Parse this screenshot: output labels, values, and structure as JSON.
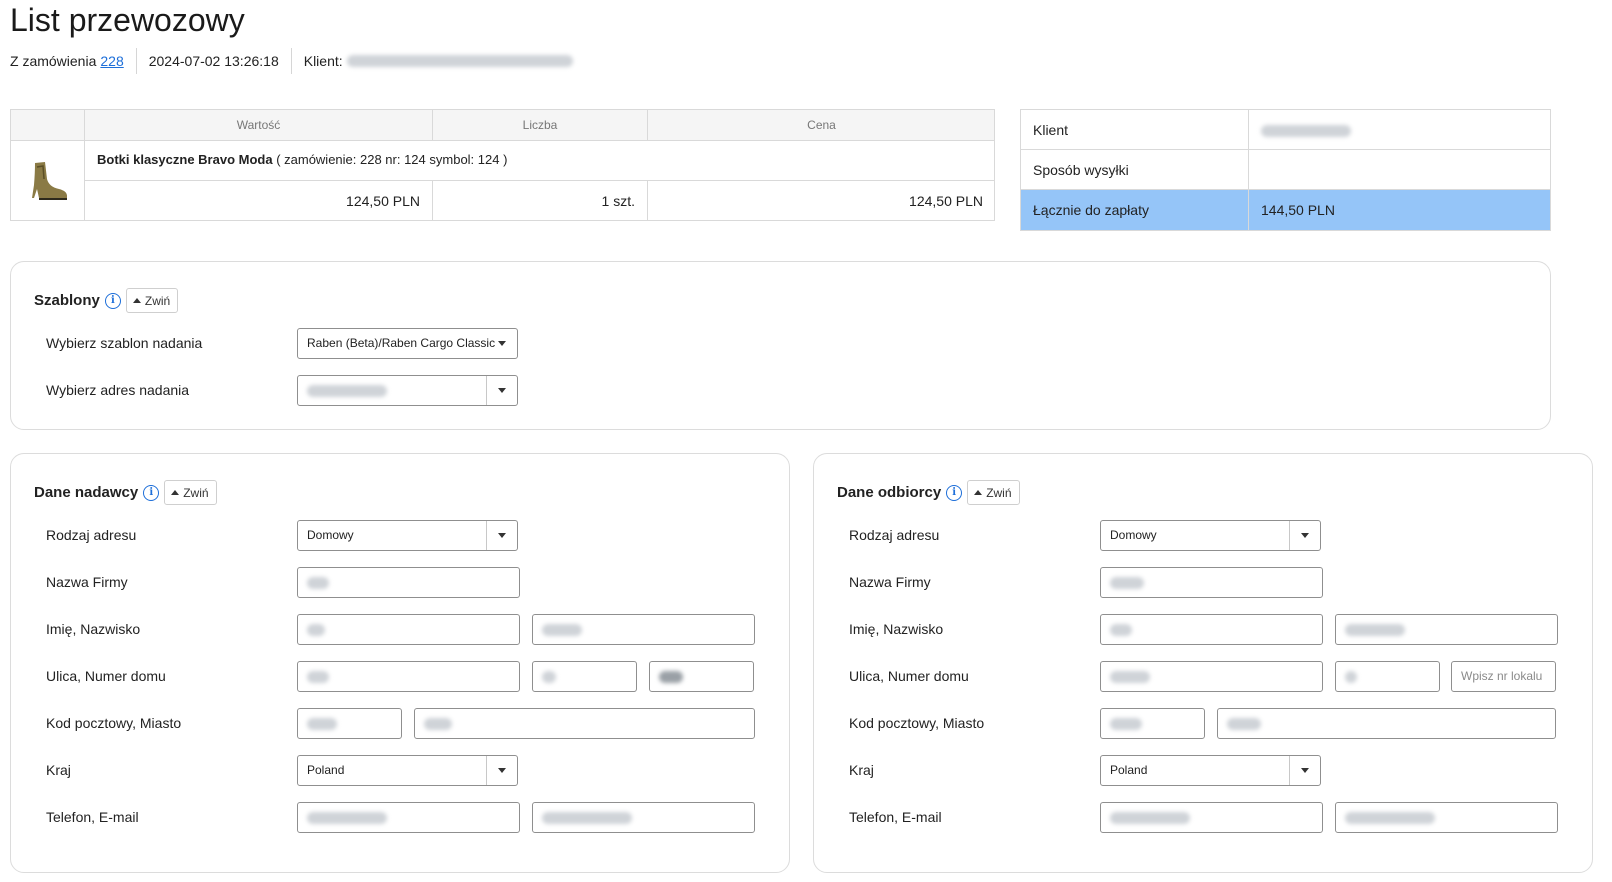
{
  "page": {
    "title": "List przewozowy"
  },
  "meta": {
    "from_order_label": "Z zamówienia",
    "order_number": "228",
    "datetime": "2024-07-02 13:26:18",
    "client_label": "Klient:"
  },
  "order_table": {
    "headers": [
      "Wartość",
      "Liczba",
      "Cena"
    ],
    "product_name": "Botki klasyczne Bravo Moda",
    "product_details": "( zamówienie: 228 nr: 124 symbol: 124 )",
    "value": "124,50 PLN",
    "quantity": "1 szt.",
    "price": "124,50 PLN"
  },
  "summary": {
    "client_label": "Klient",
    "shipping_label": "Sposób wysyłki",
    "total_label": "Łącznie do zapłaty",
    "total_value": "144,50 PLN",
    "total_color": "#95c5f8"
  },
  "templates": {
    "title": "Szablony",
    "collapse_label": "Zwiń",
    "template_label": "Wybierz szablon nadania",
    "template_value": "Raben (Beta)/Raben Cargo Classic",
    "address_label": "Wybierz adres nadania"
  },
  "sender": {
    "title": "Dane nadawcy",
    "collapse_label": "Zwiń",
    "address_type_label": "Rodzaj adresu",
    "address_type_value": "Domowy",
    "company_label": "Nazwa Firmy",
    "name_label": "Imię, Nazwisko",
    "street_label": "Ulica, Numer domu",
    "postal_label": "Kod pocztowy, Miasto",
    "country_label": "Kraj",
    "country_value": "Poland",
    "contact_label": "Telefon, E-mail"
  },
  "recipient": {
    "title": "Dane odbiorcy",
    "collapse_label": "Zwiń",
    "address_type_label": "Rodzaj adresu",
    "address_type_value": "Domowy",
    "company_label": "Nazwa Firmy",
    "name_label": "Imię, Nazwisko",
    "street_label": "Ulica, Numer domu",
    "apartment_placeholder": "Wpisz nr lokalu",
    "postal_label": "Kod pocztowy, Miasto",
    "country_label": "Kraj",
    "country_value": "Poland",
    "contact_label": "Telefon, E-mail"
  },
  "colors": {
    "link": "#1e6fd9",
    "border": "#dcdcdc",
    "total_highlight": "#95c5f8"
  }
}
